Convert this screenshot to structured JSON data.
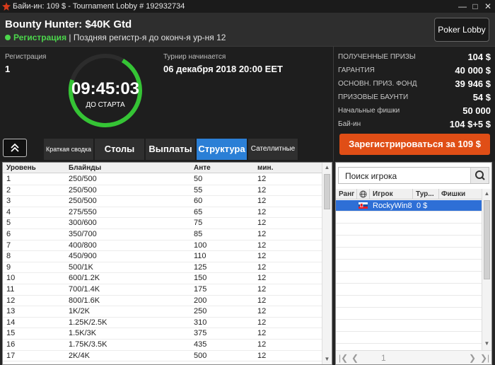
{
  "window": {
    "title": "Байи-ин: 109 $ - Tournament Lobby # 192932734"
  },
  "header": {
    "tournament_name": "Bounty Hunter: $40K Gtd",
    "status": "Регистрация",
    "status_note": "| Поздняя регистр-я до оконч-я ур-ня 12",
    "lobby_button": "Poker Lobby"
  },
  "info": {
    "registration_label": "Регистрация",
    "registration_value": "1",
    "timer_value": "09:45:03",
    "timer_label": "ДО СТАРТА",
    "start_label": "Турнир начинается",
    "start_value": "06 декабря 2018  20:00 EET"
  },
  "prizes": [
    {
      "label": "ПОЛУЧЕННЫЕ ПРИЗЫ",
      "value": "104 $"
    },
    {
      "label": "ГАРАНТИЯ",
      "value": "40 000 $"
    },
    {
      "label": "ОСНОВН. ПРИЗ. ФОНД",
      "value": "39 946 $"
    },
    {
      "label": "ПРИЗОВЫЕ БАУНТИ",
      "value": "54 $"
    },
    {
      "label": "Начальные фишки",
      "value": "50 000"
    },
    {
      "label": "Бай-ин",
      "value": "104 $+5 $"
    }
  ],
  "register_button": "Зарегистрироваться за  109 $",
  "tabs": [
    {
      "label": "Краткая сводка"
    },
    {
      "label": "Столы"
    },
    {
      "label": "Выплаты"
    },
    {
      "label": "Структура"
    },
    {
      "label": "Сателлитные"
    }
  ],
  "structure": {
    "headers": [
      "Уровень",
      "Блайнды",
      "Анте",
      "мин."
    ],
    "rows": [
      [
        "1",
        "250/500",
        "50",
        "12"
      ],
      [
        "2",
        "250/500",
        "55",
        "12"
      ],
      [
        "3",
        "250/500",
        "60",
        "12"
      ],
      [
        "4",
        "275/550",
        "65",
        "12"
      ],
      [
        "5",
        "300/600",
        "75",
        "12"
      ],
      [
        "6",
        "350/700",
        "85",
        "12"
      ],
      [
        "7",
        "400/800",
        "100",
        "12"
      ],
      [
        "8",
        "450/900",
        "110",
        "12"
      ],
      [
        "9",
        "500/1K",
        "125",
        "12"
      ],
      [
        "10",
        "600/1.2K",
        "150",
        "12"
      ],
      [
        "11",
        "700/1.4K",
        "175",
        "12"
      ],
      [
        "12",
        "800/1.6K",
        "200",
        "12"
      ],
      [
        "13",
        "1K/2K",
        "250",
        "12"
      ],
      [
        "14",
        "1.25K/2.5K",
        "310",
        "12"
      ],
      [
        "15",
        "1.5K/3K",
        "375",
        "12"
      ],
      [
        "16",
        "1.75K/3.5K",
        "435",
        "12"
      ],
      [
        "17",
        "2K/4K",
        "500",
        "12"
      ]
    ]
  },
  "players": {
    "search_placeholder": "Поиск игрока",
    "headers": [
      "Ранг",
      "Игрок",
      "Тур...",
      "Фишки"
    ],
    "rows": [
      {
        "player": "RockyWin8:",
        "bounty": "0 $"
      }
    ],
    "page": "1"
  }
}
